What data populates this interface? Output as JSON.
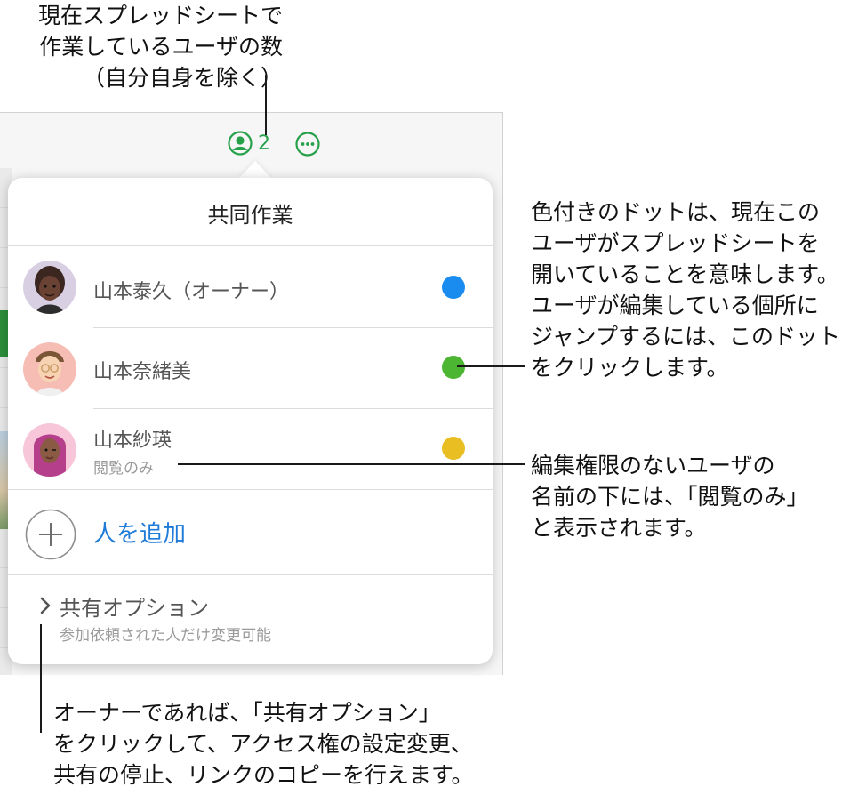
{
  "callouts": {
    "top": "現在スプレッドシートで\n作業しているユーザの数\n（自分自身を除く）",
    "right_dots": "色付きのドットは、現在この\nユーザがスプレッドシートを\n開いていることを意味します。\nユーザが編集している個所に\nジャンプするには、このドット\nをクリックします。",
    "right_view_only": "編集権限のないユーザの\n名前の下には、「閲覧のみ」\nと表示されます。",
    "bottom": "オーナーであれば、「共有オプション」\nをクリックして、アクセス権の設定変更、\n共有の停止、リンクのコピーを行えます。"
  },
  "toolbar": {
    "collaborator_count": "2",
    "collab_icon": "person-circle-icon",
    "more_icon": "ellipsis-circle-icon",
    "accent_color": "#27a04a"
  },
  "popover": {
    "title": "共同作業",
    "participants": [
      {
        "name": "山本泰久（オーナー）",
        "subtitle": "",
        "dot_color": "#1a8cf0",
        "avatar": "memoji-dark-hair-avatar"
      },
      {
        "name": "山本奈緒美",
        "subtitle": "",
        "dot_color": "#4cb531",
        "avatar": "memoji-glasses-avatar"
      },
      {
        "name": "山本紗瑛",
        "subtitle": "閲覧のみ",
        "dot_color": "#e8be22",
        "avatar": "memoji-pink-hair-avatar"
      }
    ],
    "add_person": {
      "label": "人を追加",
      "icon": "plus-circle-icon",
      "color": "#1f7bd8"
    },
    "share_options": {
      "title": "共有オプション",
      "subtitle": "参加依頼された人だけ変更可能",
      "icon": "chevron-right-icon"
    }
  }
}
